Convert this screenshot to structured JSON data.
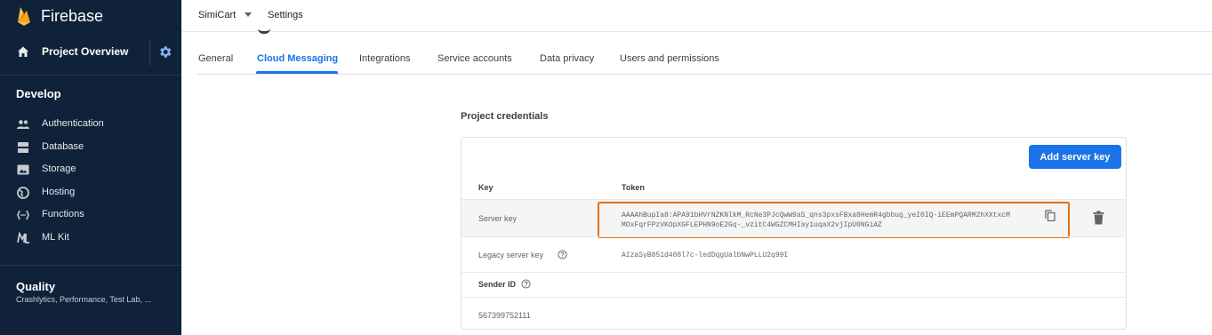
{
  "sidebar": {
    "brand": "Firebase",
    "overview_label": "Project Overview",
    "develop_title": "Develop",
    "develop_items": [
      {
        "label": "Authentication",
        "icon": "people-icon"
      },
      {
        "label": "Database",
        "icon": "database-icon"
      },
      {
        "label": "Storage",
        "icon": "storage-icon"
      },
      {
        "label": "Hosting",
        "icon": "globe-icon"
      },
      {
        "label": "Functions",
        "icon": "functions-icon"
      },
      {
        "label": "ML Kit",
        "icon": "ml-kit-icon"
      }
    ],
    "quality_title": "Quality",
    "quality_sub": "Crashlytics, Performance, Test Lab, ..."
  },
  "topbar": {
    "project": "SimiCart",
    "crumb": "Settings"
  },
  "tabs": [
    {
      "label": "General",
      "active": false
    },
    {
      "label": "Cloud Messaging",
      "active": true
    },
    {
      "label": "Integrations",
      "active": false
    },
    {
      "label": "Service accounts",
      "active": false
    },
    {
      "label": "Data privacy",
      "active": false
    },
    {
      "label": "Users and permissions",
      "active": false
    }
  ],
  "credentials": {
    "title": "Project credentials",
    "add_button": "Add server key",
    "col_key": "Key",
    "col_token": "Token",
    "server_key_label": "Server key",
    "server_key_token": "AAAAhBupIa8:APA91bHVrNZKNlkM_RcNe3PJcQwW9aS_qns3pxsFBxa8HemR4gbbug_yeI0IQ-iEEmPQARM2hXXtxcMMOxFqrFPzVKOpXGFLEPHN9oE2Gq-_vzitC4WGZCMHIay1uqaX2vjIpU0NGiAZ",
    "legacy_label": "Legacy server key",
    "legacy_value": "AIzaSyB851d408l7c-ledDqgUalbNwPLLU2q99I",
    "sender_label": "Sender ID",
    "sender_value": "567399752111"
  },
  "colors": {
    "sidebar_bg": "#0f2239",
    "accent": "#1a73e8",
    "highlight": "#e8710a"
  }
}
